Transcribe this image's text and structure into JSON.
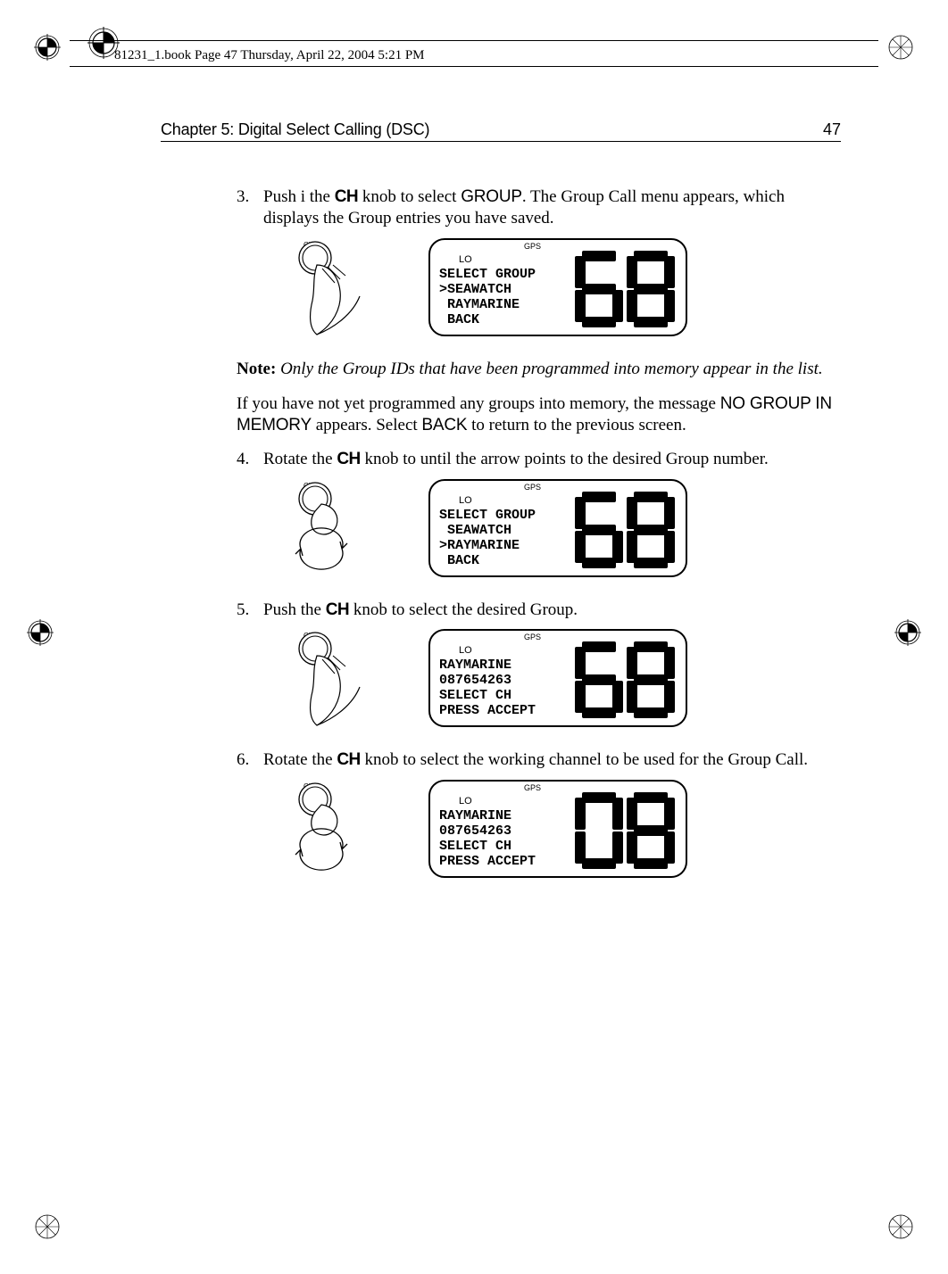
{
  "print_meta": {
    "header_note": "81231_1.book  Page 47  Thursday, April 22, 2004  5:21 PM"
  },
  "running_head": {
    "chapter": "Chapter 5: Digital Select Calling (DSC)",
    "page_number": "47"
  },
  "steps": {
    "s3": {
      "num": "3.",
      "text_prefix": "Push i the ",
      "knob": "CH",
      "text_mid": " knob to select ",
      "menu_item": "GROUP",
      "text_suffix": ". The Group Call menu appears, which displays the Group entries you have saved."
    },
    "note": {
      "label": "Note:",
      "text": "Only the Group IDs that have been programmed into memory appear in the list."
    },
    "para_after_note": {
      "prefix": "If you have not yet programmed any groups into memory, the message ",
      "msg": "NO GROUP IN MEMORY",
      "mid": " appears. Select ",
      "back": "BACK",
      "suffix": " to return to the previous screen."
    },
    "s4": {
      "num": "4.",
      "text_prefix": "Rotate the ",
      "knob": "CH",
      "text_suffix": " knob to until the arrow points to the desired Group number."
    },
    "s5": {
      "num": "5.",
      "text_prefix": "Push the ",
      "knob": "CH",
      "text_suffix": " knob to select the desired Group."
    },
    "s6": {
      "num": "6.",
      "text_prefix": "Rotate the ",
      "knob": "CH",
      "text_suffix": " knob to select the working channel to be used for the Group Call."
    }
  },
  "lcd_common": {
    "gps": "GPS",
    "lo": "LO"
  },
  "lcd1": {
    "line1": "SELECT GROUP",
    "line2": ">SEAWATCH",
    "line3": " RAYMARINE",
    "line4": " BACK",
    "channel": "68"
  },
  "lcd2": {
    "line1": "SELECT GROUP",
    "line2": " SEAWATCH",
    "line3": ">RAYMARINE",
    "line4": " BACK",
    "channel": "68"
  },
  "lcd3": {
    "line1": "RAYMARINE",
    "line2": "087654263",
    "line3": "SELECT CH",
    "line4": "PRESS ACCEPT",
    "channel": "68"
  },
  "lcd4": {
    "line1": "RAYMARINE",
    "line2": "087654263",
    "line3": "SELECT CH",
    "line4": "PRESS ACCEPT",
    "channel": "08"
  },
  "knob_label": "CH"
}
